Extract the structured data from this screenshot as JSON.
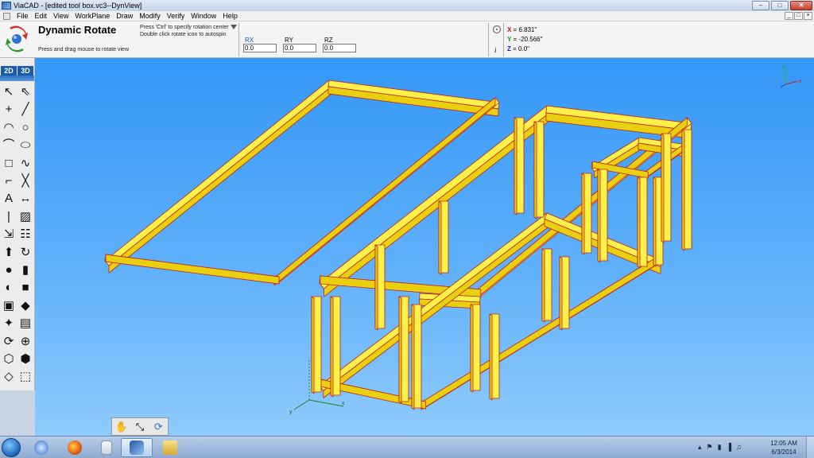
{
  "window": {
    "title": "ViaCAD - [edited tool box.vc3--DynView]",
    "controls": [
      "–",
      "□",
      "✕"
    ]
  },
  "menubar": {
    "items": [
      "File",
      "Edit",
      "View",
      "WorkPlane",
      "Draw",
      "Modify",
      "Verify",
      "Window",
      "Help"
    ],
    "mdi_controls": [
      "_",
      "□",
      "×"
    ]
  },
  "inspector": {
    "tool_name": "Dynamic Rotate",
    "hint": "Press and drag mouse to rotate view",
    "tip_line1": "Press 'Ctrl' to specify rotation center",
    "tip_line2": "Double click rotate icon to autospin",
    "fields": [
      {
        "label": "RX",
        "value": "0.0"
      },
      {
        "label": "RY",
        "value": "0.0"
      },
      {
        "label": "RZ",
        "value": "0.0"
      }
    ],
    "info_glyph": "i",
    "coords": {
      "x_label": "X",
      "x_value": "= 6.831\"",
      "y_label": "Y",
      "y_value": "= -20.566\"",
      "z_label": "Z",
      "z_value": "= 0.0\""
    },
    "colors": {
      "x": "#d01010",
      "y": "#109010",
      "z": "#1020d0"
    }
  },
  "left_toolbar": {
    "tabs": [
      "2D",
      "3D"
    ],
    "tools": [
      "select-arrow-icon",
      "select-pointer-icon",
      "point-icon",
      "line-icon",
      "arc-icon",
      "circle-icon",
      "curve-icon",
      "ellipse-icon",
      "rectangle-icon",
      "spline-icon",
      "fillet-icon",
      "trim-icon",
      "text-icon",
      "dimension-icon",
      "vertical-line-icon",
      "hatch-icon",
      "transform-icon",
      "pattern-icon",
      "extrude-icon",
      "revolve-icon",
      "sphere-icon",
      "cylinder-icon",
      "boolean-icon",
      "box-icon",
      "shell-icon",
      "solid-icon",
      "render-icon",
      "layers-icon",
      "rotate-view-icon",
      "zoom-icon",
      "view-front-icon",
      "view-iso-icon",
      "view-solid-icon",
      "view-top-icon"
    ],
    "glyphs": [
      "↖",
      "⇖",
      "+",
      "╱",
      "◠",
      "○",
      "⌒",
      "⬭",
      "□",
      "∿",
      "⌐",
      "╳",
      "A",
      "↔",
      "|",
      "▨",
      "⇲",
      "☷",
      "⬆",
      "↻",
      "●",
      "▮",
      "◐",
      "■",
      "▣",
      "◆",
      "✦",
      "▤",
      "⟳",
      "⊕",
      "⬡",
      "⬢",
      "◇",
      "⬚"
    ]
  },
  "view_tools": {
    "glyphs": [
      "✋",
      "⤡",
      "⟳"
    ],
    "names": [
      "pan-icon",
      "zoom-window-icon",
      "rotate-icon"
    ]
  },
  "axis_labels": {
    "x": "x",
    "y": "y",
    "z": "z"
  },
  "taskbar": {
    "clock_time": "12:05 AM",
    "clock_date": "6/3/2014",
    "tray_glyphs": [
      "▴",
      "⚑",
      "▮",
      "▐",
      "♫"
    ]
  }
}
